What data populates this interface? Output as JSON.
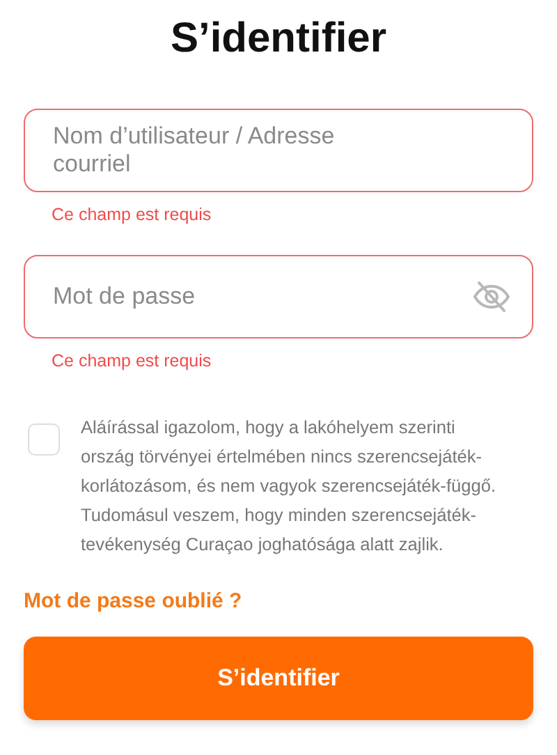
{
  "title": "S’identifier",
  "fields": [
    {
      "placeholder": "Nom d’utilisateur / Adresse courriel",
      "invalid": true,
      "error": "Ce champ est requis",
      "kind": "text"
    },
    {
      "placeholder": "Mot de passe",
      "invalid": true,
      "error": "Ce champ est requis",
      "kind": "password",
      "password_visible": false
    }
  ],
  "consent": {
    "checked": false,
    "text": "Aláírással igazolom, hogy a lakóhelyem szerinti ország törvényei értelmében nincs szerencsejáték-korlátozásom, és nem vagyok szerencsejáték-függő. Tudomásul veszem, hogy minden szerencsejáték-tevékenység Curaçao joghatósága alatt zajlik."
  },
  "forgot_link": "Mot de passe oublié ?",
  "submit_button": "S’identifier"
}
